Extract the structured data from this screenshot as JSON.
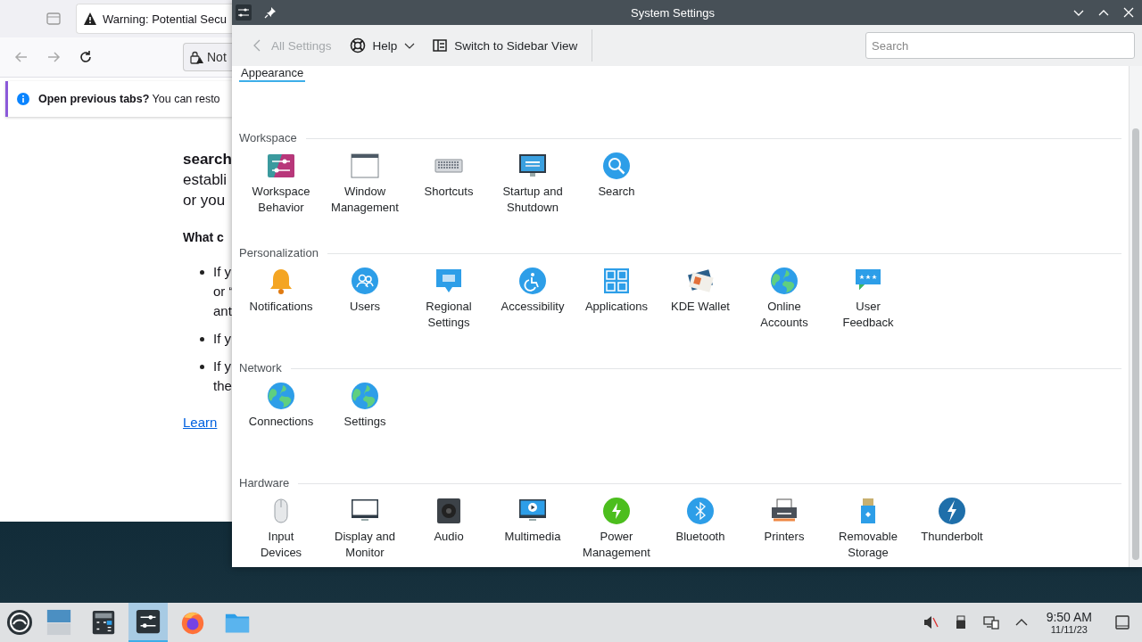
{
  "browser": {
    "tab": {
      "title": "Warning: Potential Secu"
    },
    "url": "Not",
    "notice": "**Open previous tabs?** You can resto",
    "page": {
      "heading": "search",
      "lines": [
        "establi",
        "or you"
      ],
      "subheading": "What c",
      "bullets": [
        [
          "If y",
          "or “",
          "ant"
        ],
        [
          "If y"
        ],
        [
          "If y",
          "the"
        ]
      ],
      "link": "Learn"
    }
  },
  "settings": {
    "window": {
      "title": "System Settings"
    },
    "toolbar": {
      "back": {
        "label": "All Settings",
        "disabled": true
      },
      "help": "Help",
      "switch": "Switch to Sidebar View",
      "search": {
        "placeholder": "Search"
      }
    },
    "sections": [
      {
        "title": "Appearance",
        "selected": true
      },
      {
        "title": "Workspace",
        "selected": false,
        "items": [
          "Workspace Behavior",
          "Window Management",
          "Shortcuts",
          "Startup and Shutdown",
          "Search"
        ]
      },
      {
        "title": "Personalization",
        "selected": false,
        "items": [
          "Notifications",
          "Users",
          "Regional Settings",
          "Accessibility",
          "Applications",
          "KDE Wallet",
          "Online Accounts",
          "User Feedback"
        ]
      },
      {
        "title": "Network",
        "selected": false,
        "items": [
          "Connections",
          "Settings"
        ]
      },
      {
        "title": "Hardware",
        "selected": false,
        "items": [
          "Input Devices",
          "Display and Monitor",
          "Audio",
          "Multimedia",
          "Power Management",
          "Bluetooth",
          "Printers",
          "Removable Storage",
          "Thunderbolt"
        ]
      }
    ]
  },
  "taskbar": {
    "tasks": [
      {
        "active": false
      },
      {
        "active": false
      },
      {
        "active": true
      },
      {
        "active": false
      },
      {
        "active": false
      }
    ],
    "clock": {
      "time": "9:50 AM",
      "date": "11/11/23"
    }
  }
}
